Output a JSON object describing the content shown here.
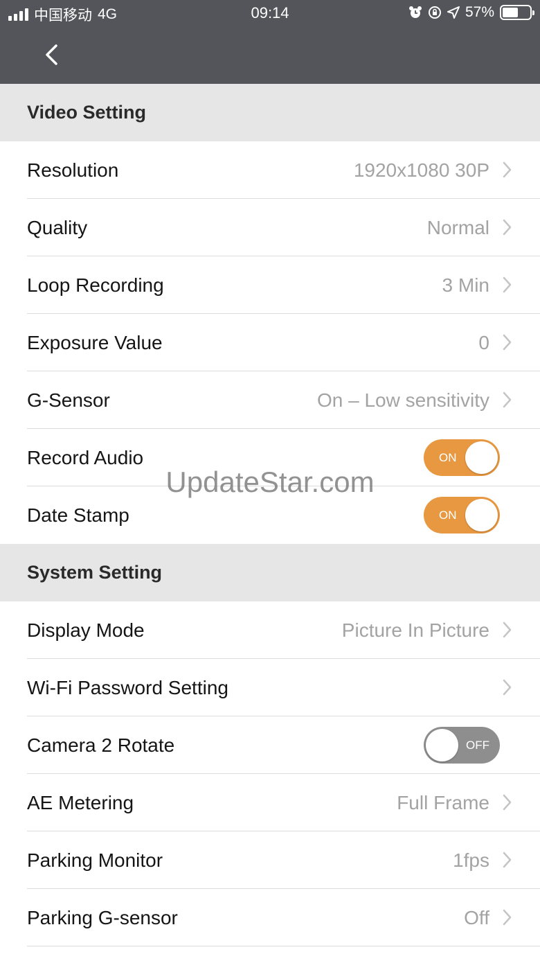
{
  "status_bar": {
    "carrier": "中国移动",
    "network": "4G",
    "time": "09:14",
    "battery_text": "57%",
    "battery_level": 0.57
  },
  "nav": {
    "back_icon": "chevron-left-icon"
  },
  "sections": {
    "video": {
      "title": "Video Setting",
      "resolution": {
        "label": "Resolution",
        "value": "1920x1080 30P"
      },
      "quality": {
        "label": "Quality",
        "value": "Normal"
      },
      "loop_recording": {
        "label": "Loop Recording",
        "value": "3 Min"
      },
      "exposure_value": {
        "label": "Exposure Value",
        "value": "0"
      },
      "g_sensor": {
        "label": "G-Sensor",
        "value": "On – Low sensitivity"
      },
      "record_audio": {
        "label": "Record Audio",
        "toggle_text": "ON",
        "enabled": true
      },
      "date_stamp": {
        "label": "Date Stamp",
        "toggle_text": "ON",
        "enabled": true
      }
    },
    "system": {
      "title": "System Setting",
      "display_mode": {
        "label": "Display Mode",
        "value": "Picture In Picture"
      },
      "wifi_password": {
        "label": "Wi-Fi Password Setting"
      },
      "camera2_rotate": {
        "label": "Camera 2 Rotate",
        "toggle_text": "OFF",
        "enabled": false
      },
      "ae_metering": {
        "label": "AE Metering",
        "value": "Full Frame"
      },
      "parking_monitor": {
        "label": "Parking Monitor",
        "value": "1fps"
      },
      "parking_g_sensor": {
        "label": "Parking G-sensor",
        "value": "Off"
      }
    }
  },
  "watermark": "UpdateStar.com",
  "colors": {
    "header_bg": "#54555a",
    "section_bg": "#e6e6e6",
    "toggle_on": "#e89840",
    "toggle_off": "#8e8e8e",
    "value_text": "#a3a3a3"
  }
}
